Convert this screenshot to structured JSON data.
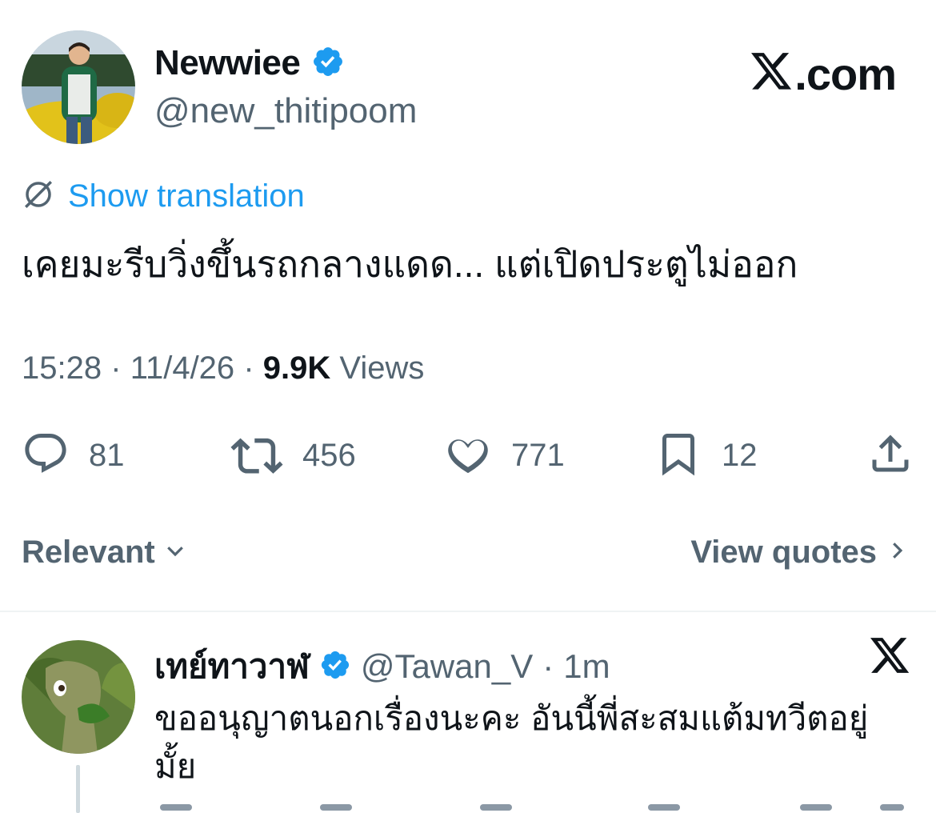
{
  "tweet": {
    "author_name": "Newwiee",
    "author_handle": "@new_thitipoom",
    "brand": "X.com",
    "show_translation": "Show translation",
    "text": "เคยมะรีบวิ่งขึ้นรถกลางแดด... แต่เปิดประตูไม่ออก",
    "time": "15:28",
    "date": "11/4/26",
    "views_count": "9.9K",
    "views_label": "Views",
    "separator": "·"
  },
  "actions": {
    "replies": "81",
    "reposts": "456",
    "likes": "771",
    "bookmarks": "12"
  },
  "filters": {
    "relevant": "Relevant",
    "view_quotes": "View quotes"
  },
  "reply": {
    "author_name": "เทย์ทาวาฬ",
    "author_handle": "@Tawan_V",
    "separator": "·",
    "age": "1m",
    "text": "ขออนุญาตนอกเรื่องนะคะ อันนี้พี่สะสมแต้มทวีตอยู่มั้ย"
  },
  "colors": {
    "verified": "#1d9bf0",
    "link": "#1d9bf0",
    "secondary_text": "#536471",
    "primary_text": "#0f1419"
  },
  "icons": [
    "verified-badge-icon",
    "x-logo-icon",
    "translate-icon",
    "reply-icon",
    "repost-icon",
    "like-icon",
    "bookmark-icon",
    "share-icon",
    "chevron-down-icon",
    "chevron-right-icon"
  ]
}
